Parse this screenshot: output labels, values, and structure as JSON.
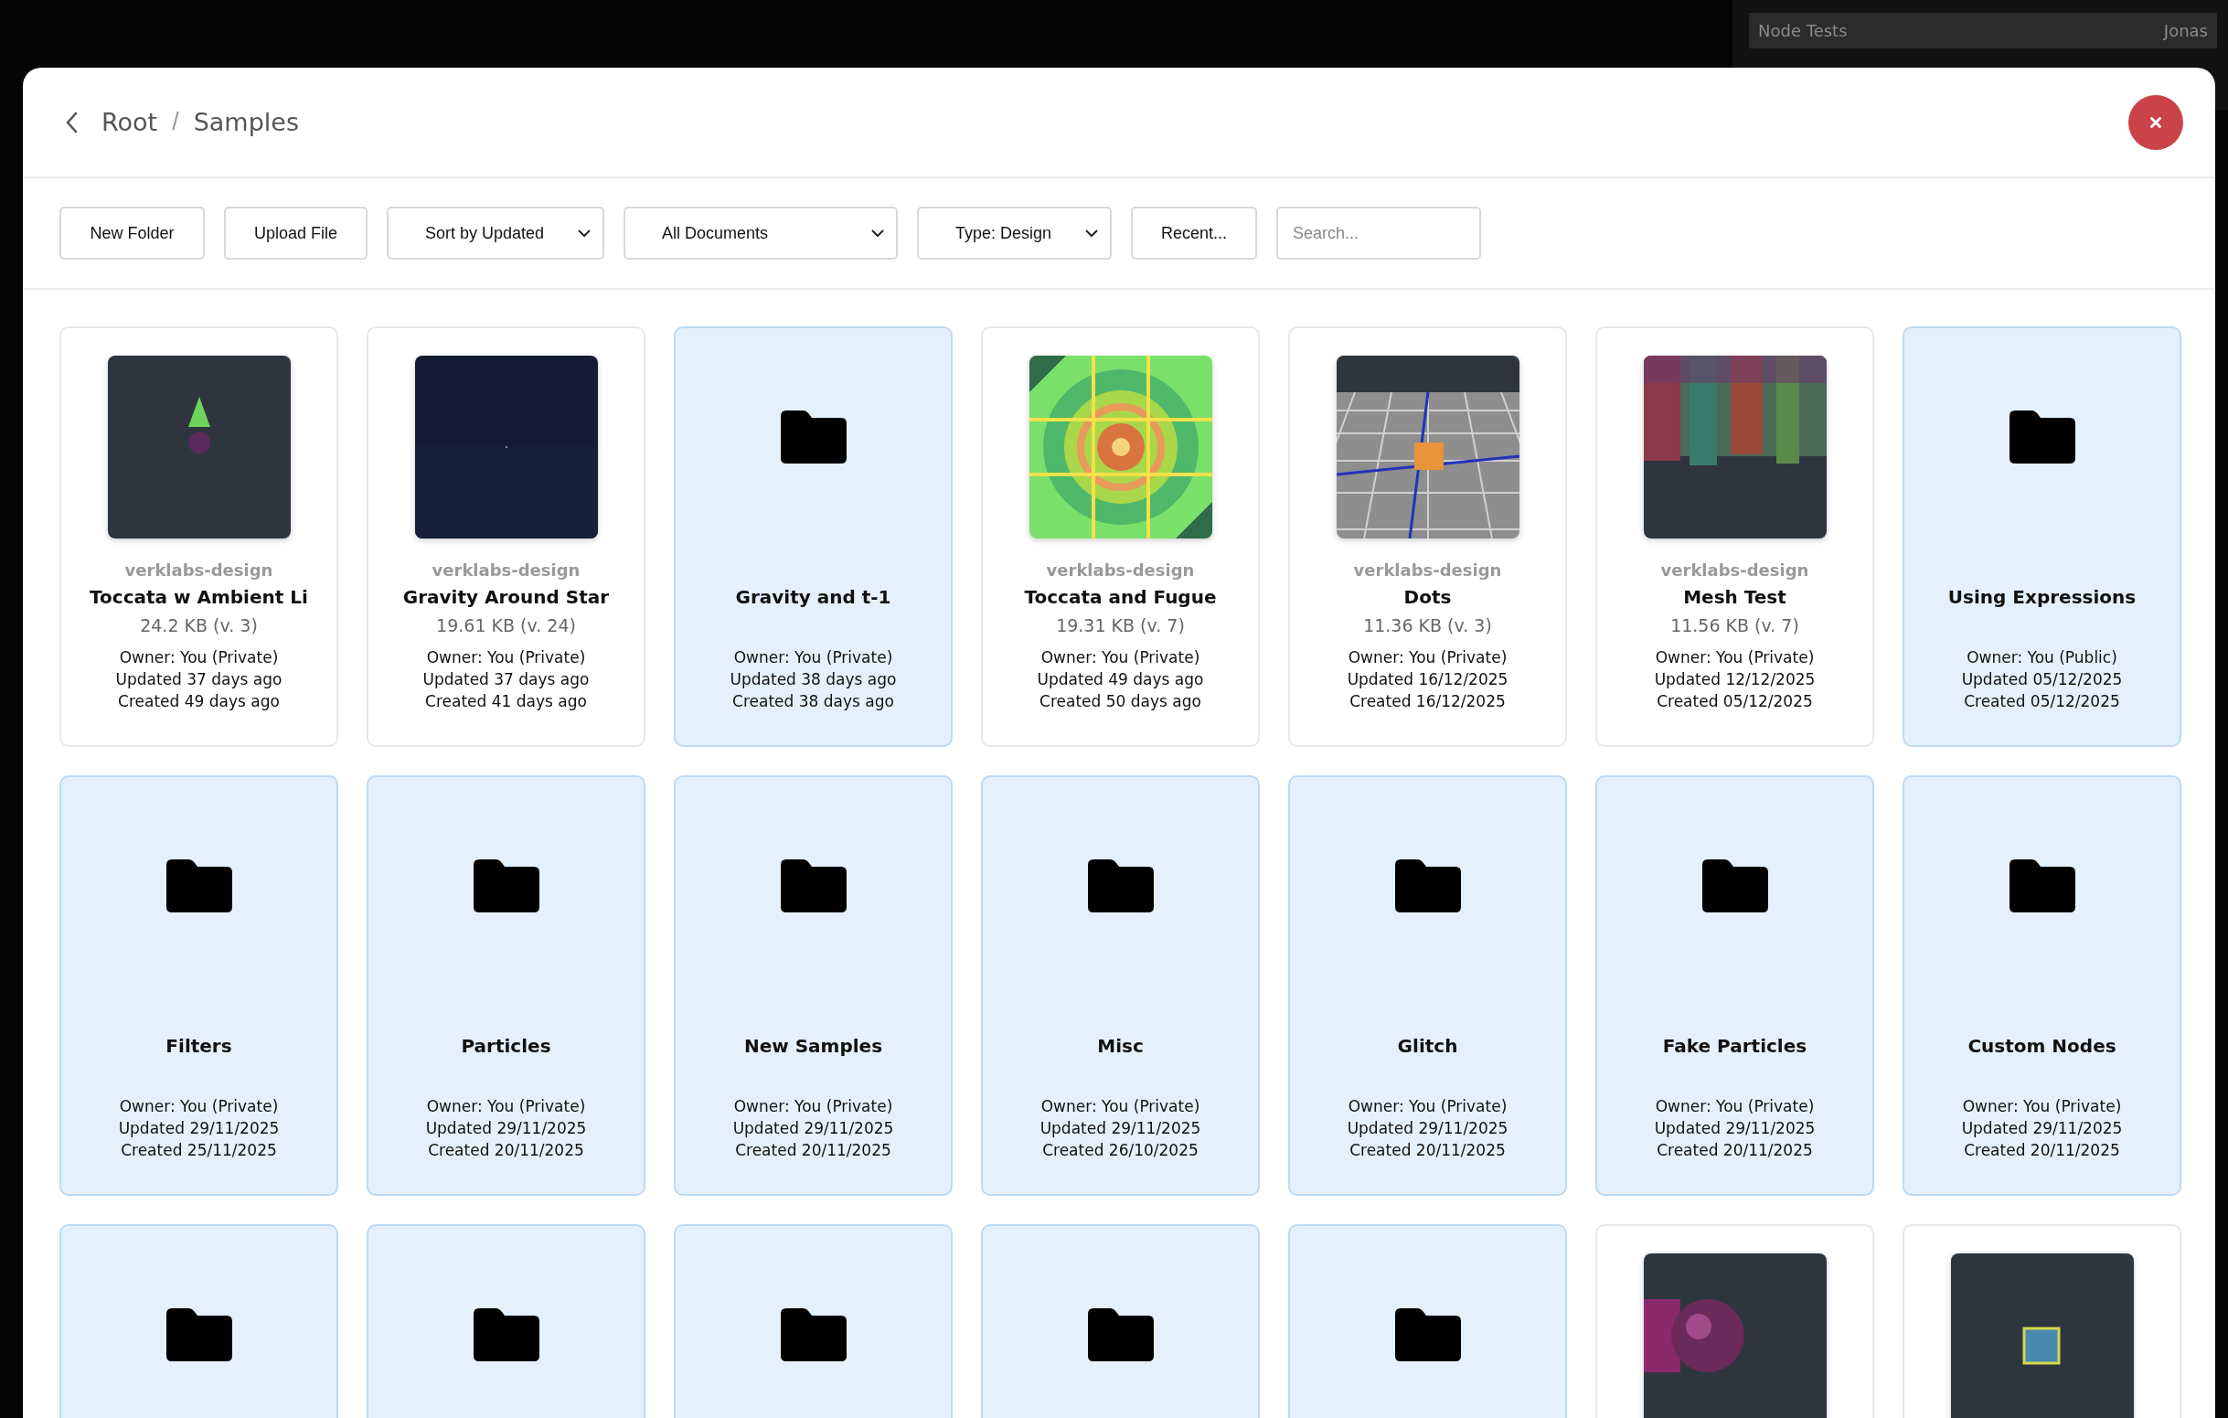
{
  "background_window": {
    "project_title": "Node Tests",
    "user": "Jonas"
  },
  "breadcrumb": [
    {
      "label": "Root"
    },
    {
      "separator": "/",
      "label": "Samples"
    }
  ],
  "toolbar": [
    {
      "kind": "button",
      "label": "New Folder"
    },
    {
      "kind": "button",
      "label": "Upload File"
    },
    {
      "kind": "dropdown",
      "label": "Sort by Updated"
    },
    {
      "kind": "dropdown",
      "label": "All Documents"
    },
    {
      "kind": "dropdown",
      "label": "Type: Design"
    },
    {
      "kind": "button",
      "label": "Recent..."
    },
    {
      "kind": "search",
      "placeholder": "Search..."
    }
  ],
  "cards": [
    {
      "kind": "design",
      "team": "verklabs-design",
      "name": "Toccata w Ambient Li",
      "size": "24.2 KB (v. 3)",
      "owner": "Owner: You (Private)",
      "updated": "Updated 37 days ago",
      "created": "Created 49 days ago"
    },
    {
      "kind": "design",
      "team": "verklabs-design",
      "name": "Gravity Around Star",
      "size": "19.61 KB (v. 24)",
      "owner": "Owner: You (Private)",
      "updated": "Updated 37 days ago",
      "created": "Created 41 days ago"
    },
    {
      "kind": "folder",
      "name": "Gravity and t-1",
      "owner": "Owner: You (Private)",
      "updated": "Updated 38 days ago",
      "created": "Created 38 days ago"
    },
    {
      "kind": "design",
      "team": "verklabs-design",
      "name": "Toccata and Fugue",
      "size": "19.31 KB (v. 7)",
      "owner": "Owner: You (Private)",
      "updated": "Updated 49 days ago",
      "created": "Created 50 days ago"
    },
    {
      "kind": "design",
      "team": "verklabs-design",
      "name": "Dots",
      "size": "11.36 KB (v. 3)",
      "owner": "Owner: You (Private)",
      "updated": "Updated 16/12/2025",
      "created": "Created 16/12/2025"
    },
    {
      "kind": "design",
      "team": "verklabs-design",
      "name": "Mesh Test",
      "size": "11.56 KB (v. 7)",
      "owner": "Owner: You (Private)",
      "updated": "Updated 12/12/2025",
      "created": "Created 05/12/2025"
    },
    {
      "kind": "folder",
      "name": "Using Expressions",
      "owner": "Owner: You (Public)",
      "updated": "Updated 05/12/2025",
      "created": "Created 05/12/2025"
    },
    {
      "kind": "folder",
      "name": "Filters",
      "owner": "Owner: You (Private)",
      "updated": "Updated 29/11/2025",
      "created": "Created 25/11/2025"
    },
    {
      "kind": "folder",
      "name": "Particles",
      "owner": "Owner: You (Private)",
      "updated": "Updated 29/11/2025",
      "created": "Created 20/11/2025"
    },
    {
      "kind": "folder",
      "name": "New Samples",
      "owner": "Owner: You (Private)",
      "updated": "Updated 29/11/2025",
      "created": "Created 20/11/2025"
    },
    {
      "kind": "folder",
      "name": "Misc",
      "owner": "Owner: You (Private)",
      "updated": "Updated 29/11/2025",
      "created": "Created 26/10/2025"
    },
    {
      "kind": "folder",
      "name": "Glitch",
      "owner": "Owner: You (Private)",
      "updated": "Updated 29/11/2025",
      "created": "Created 20/11/2025"
    },
    {
      "kind": "folder",
      "name": "Fake Particles",
      "owner": "Owner: You (Private)",
      "updated": "Updated 29/11/2025",
      "created": "Created 20/11/2025"
    },
    {
      "kind": "folder",
      "name": "Custom Nodes",
      "owner": "Owner: You (Private)",
      "updated": "Updated 29/11/2025",
      "created": "Created 20/11/2025"
    },
    {
      "kind": "folder"
    },
    {
      "kind": "folder"
    },
    {
      "kind": "folder"
    },
    {
      "kind": "folder"
    },
    {
      "kind": "folder"
    },
    {
      "kind": "design"
    },
    {
      "kind": "design"
    }
  ]
}
